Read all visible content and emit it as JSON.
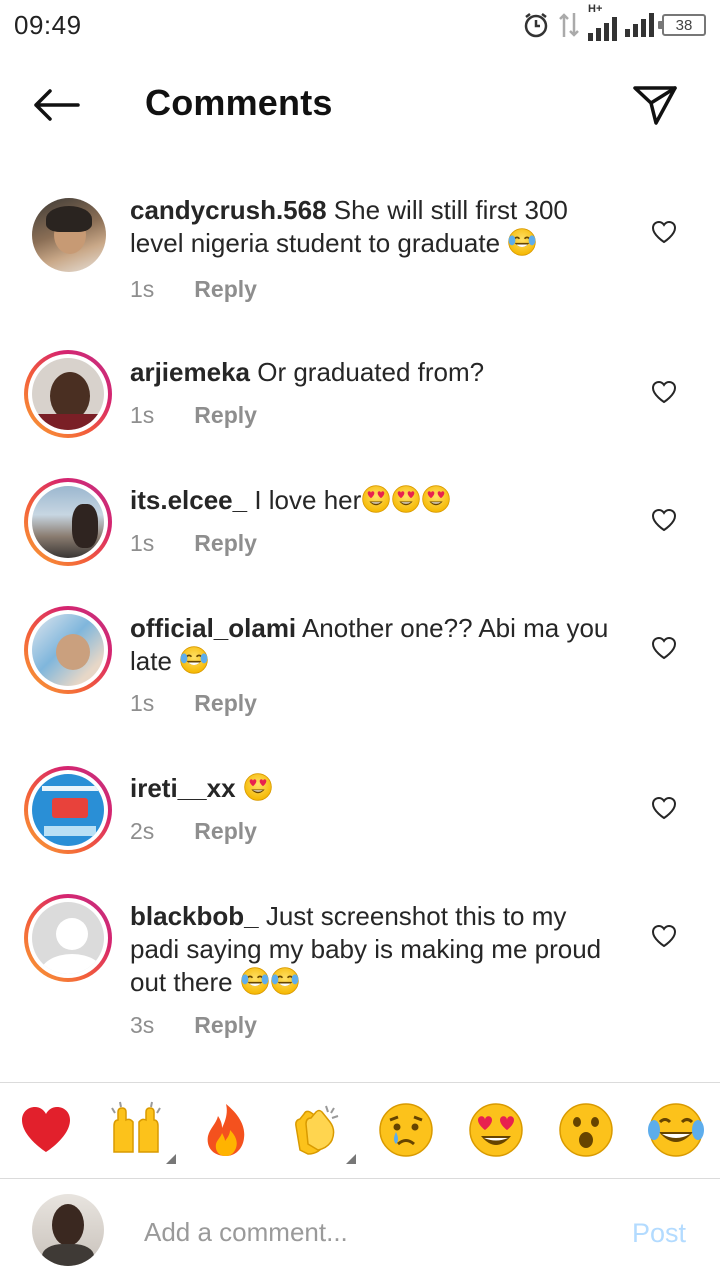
{
  "status_bar": {
    "time": "09:49",
    "network": "H+",
    "battery": "38"
  },
  "header": {
    "title": "Comments"
  },
  "comments": [
    {
      "username": "candycrush.568",
      "text": "She will still first 300 level nigeria student to graduate",
      "emoji": "joy",
      "time": "1s",
      "reply": "Reply"
    },
    {
      "username": "arjiemeka",
      "text": "Or graduated from?",
      "time": "1s",
      "reply": "Reply"
    },
    {
      "username": "its.elcee_",
      "text": "I love her",
      "emoji": "heart-eyes x3",
      "time": "1s",
      "reply": "Reply"
    },
    {
      "username": "official_olami",
      "text": "Another one?? Abi ma you late",
      "emoji": "joy",
      "time": "1s",
      "reply": "Reply"
    },
    {
      "username": "ireti__xx",
      "text": "",
      "emoji": "heart-eyes",
      "time": "2s",
      "reply": "Reply"
    },
    {
      "username": "blackbob_",
      "text": "Just screenshot this to my padi saying my baby is making me proud out there",
      "emoji": "joy x2",
      "time": "3s",
      "reply": "Reply"
    }
  ],
  "emoji_bar": [
    "red-heart",
    "raising-hands",
    "fire",
    "clapping-hands",
    "crying-face",
    "heart-eyes-face",
    "surprised-face",
    "tears-of-joy-face"
  ],
  "input": {
    "placeholder": "Add a comment...",
    "post_label": "Post"
  },
  "colors": {
    "post_disabled": "#b3dbff",
    "story_ring_start": "#f9a334",
    "story_ring_end": "#c13584",
    "meta_gray": "#8e8e8e"
  }
}
